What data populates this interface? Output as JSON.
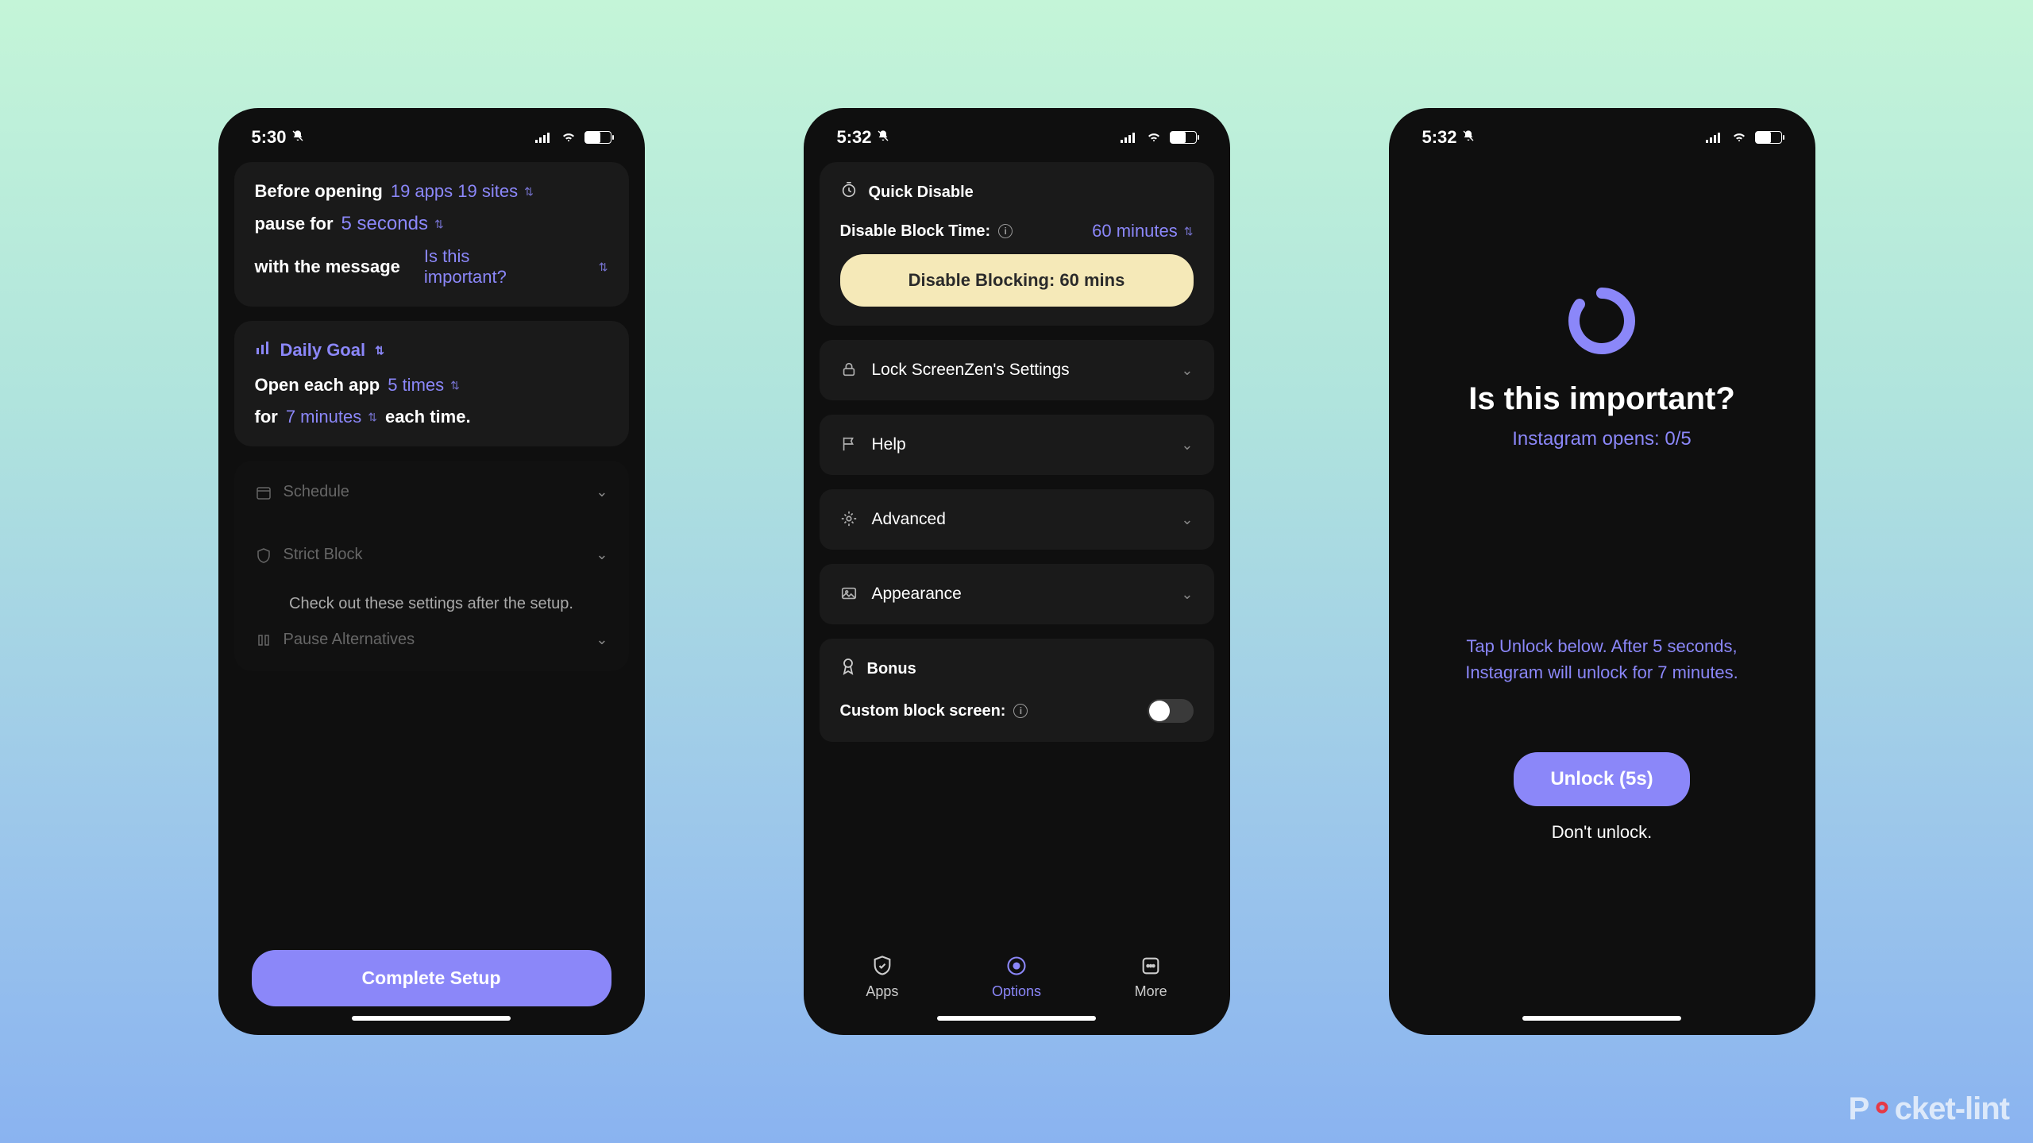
{
  "watermark": "Pocket-lint",
  "phone1": {
    "time": "5:30",
    "before_opening_label": "Before opening",
    "apps_sites": "19 apps 19 sites",
    "pause_for_label": "pause for",
    "pause_duration": "5 seconds",
    "with_message_label": "with the message",
    "message_value": "Is this important?",
    "daily_goal_label": "Daily Goal",
    "open_each_label": "Open each app",
    "open_times": "5 times",
    "for_label": "for",
    "for_duration": "7 minutes",
    "each_time_label": "each time.",
    "schedule": "Schedule",
    "strict_block": "Strict Block",
    "pause_alt": "Pause Alternatives",
    "hint": "Check out these settings after the setup.",
    "complete_btn": "Complete Setup"
  },
  "phone2": {
    "time": "5:32",
    "quick_disable": "Quick Disable",
    "disable_time_label": "Disable Block Time:",
    "disable_time_value": "60 minutes",
    "disable_btn": "Disable Blocking: 60 mins",
    "lock_settings": "Lock ScreenZen's Settings",
    "help": "Help",
    "advanced": "Advanced",
    "appearance": "Appearance",
    "bonus": "Bonus",
    "custom_block": "Custom block screen:",
    "tabs": {
      "apps": "Apps",
      "options": "Options",
      "more": "More"
    }
  },
  "phone3": {
    "time": "5:32",
    "question": "Is this important?",
    "counter": "Instagram opens: 0/5",
    "hint": "Tap Unlock below. After 5 seconds, Instagram will unlock for 7 minutes.",
    "unlock": "Unlock (5s)",
    "dont": "Don't unlock."
  }
}
